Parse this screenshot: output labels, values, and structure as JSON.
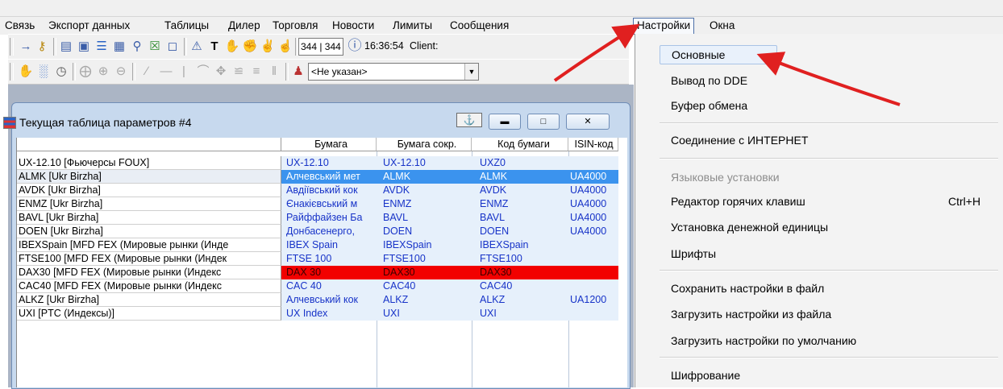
{
  "menubar": {
    "items": [
      "Связь",
      "Экспорт данных",
      "Таблицы",
      "Дилер",
      "Торговля",
      "Новости",
      "Лимиты",
      "Сообщения",
      "Настройки",
      "Окна"
    ]
  },
  "toolbar": {
    "counter": "344 | 344",
    "time": "16:36:54",
    "client_label": "Client:",
    "combo_value": "<Не указан>"
  },
  "window": {
    "title": "Текущая таблица параметров #4",
    "columns": [
      "",
      "Бумага",
      "Бумага сокр.",
      "Код бумаги",
      "ISIN-код"
    ],
    "rows": [
      {
        "name": "UX-12.10 [Фьючерсы FOUX]",
        "c1": "UX-12.10",
        "c2": "UX-12.10",
        "c3": "UXZ0",
        "c4": "",
        "state": "normal"
      },
      {
        "name": "ALMK [Ukr Birzha]",
        "c1": "Алчевський мет",
        "c2": "ALMK",
        "c3": "ALMK",
        "c4": "UA4000",
        "state": "selected"
      },
      {
        "name": "AVDK [Ukr Birzha]",
        "c1": "Авдіївський кок",
        "c2": "AVDK",
        "c3": "AVDK",
        "c4": "UA4000",
        "state": "normal"
      },
      {
        "name": "ENMZ [Ukr Birzha]",
        "c1": "Єнакієвський м",
        "c2": "ENMZ",
        "c3": "ENMZ",
        "c4": "UA4000",
        "state": "normal"
      },
      {
        "name": "BAVL [Ukr Birzha]",
        "c1": "Райффайзен Ба",
        "c2": "BAVL",
        "c3": "BAVL",
        "c4": "UA4000",
        "state": "normal"
      },
      {
        "name": "DOEN [Ukr Birzha]",
        "c1": "Донбасенерго,",
        "c2": "DOEN",
        "c3": "DOEN",
        "c4": "UA4000",
        "state": "normal"
      },
      {
        "name": "IBEXSpain [MFD FEX (Мировые рынки (Инде",
        "c1": "IBEX Spain",
        "c2": "IBEXSpain",
        "c3": "IBEXSpain",
        "c4": "",
        "state": "normal"
      },
      {
        "name": "FTSE100 [MFD FEX (Мировые рынки (Индек",
        "c1": "FTSE 100",
        "c2": "FTSE100",
        "c3": "FTSE100",
        "c4": "",
        "state": "normal"
      },
      {
        "name": "DAX30 [MFD FEX (Мировые рынки (Индекс",
        "c1": "DAX 30",
        "c2": "DAX30",
        "c3": "DAX30",
        "c4": "",
        "state": "red"
      },
      {
        "name": "CAC40 [MFD FEX (Мировые рынки (Индекс",
        "c1": "CAC 40",
        "c2": "CAC40",
        "c3": "CAC40",
        "c4": "",
        "state": "normal"
      },
      {
        "name": "ALKZ [Ukr Birzha]",
        "c1": "Алчевський кок",
        "c2": "ALKZ",
        "c3": "ALKZ",
        "c4": "UA1200",
        "state": "normal"
      },
      {
        "name": "UXI [PTC (Индексы)]",
        "c1": "UX Index",
        "c2": "UXI",
        "c3": "UXI",
        "c4": "",
        "state": "normal"
      }
    ]
  },
  "dropdown": {
    "items": [
      {
        "label": "Основные",
        "shortcut": "",
        "state": "highlighted"
      },
      {
        "label": "Вывод по DDE",
        "shortcut": "",
        "state": "normal"
      },
      {
        "label": "Буфер обмена",
        "shortcut": "",
        "state": "normal"
      },
      {
        "label": "Соединение с ИНТЕРНЕТ",
        "shortcut": "",
        "state": "normal"
      },
      {
        "label": "Языковые установки",
        "shortcut": "",
        "state": "disabled"
      },
      {
        "label": "Редактор горячих клавиш",
        "shortcut": "Ctrl+H",
        "state": "normal"
      },
      {
        "label": "Установка денежной единицы",
        "shortcut": "",
        "state": "normal"
      },
      {
        "label": "Шрифты",
        "shortcut": "",
        "state": "normal"
      },
      {
        "label": "Сохранить настройки в файл",
        "shortcut": "",
        "state": "normal"
      },
      {
        "label": "Загрузить настройки из файла",
        "shortcut": "",
        "state": "normal"
      },
      {
        "label": "Загрузить настройки по умолчанию",
        "shortcut": "",
        "state": "normal"
      },
      {
        "label": "Шифрование",
        "shortcut": "",
        "state": "normal"
      }
    ]
  },
  "colors": {
    "selection": "#3b93ee",
    "highlight_red": "#f20000",
    "cell_text_blue": "#1733c8",
    "annotation_arrow": "#e02020"
  }
}
